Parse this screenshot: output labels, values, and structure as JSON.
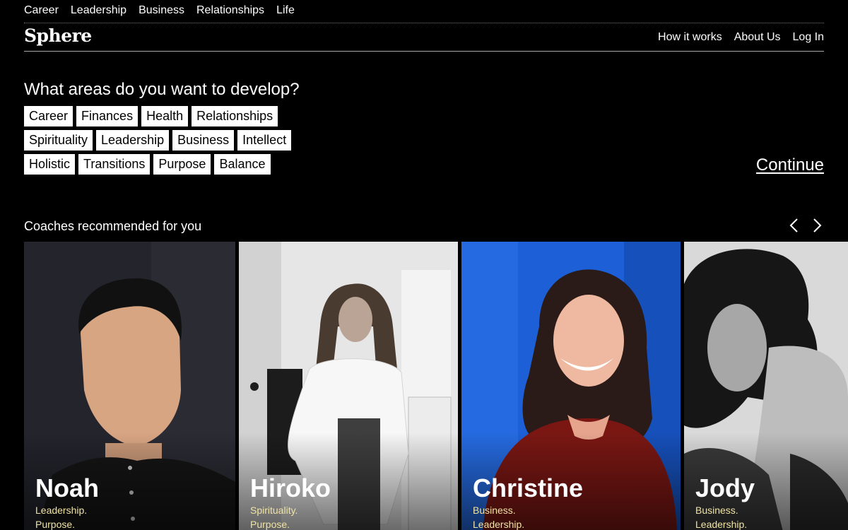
{
  "top_nav": [
    "Career",
    "Leadership",
    "Business",
    "Relationships",
    "Life"
  ],
  "logo": "Sphere",
  "main_nav": [
    "How it works",
    "About Us",
    "Log In"
  ],
  "question": "What areas do you want to develop?",
  "chip_rows": [
    [
      "Career",
      "Finances",
      "Health",
      "Relationships"
    ],
    [
      "Spirituality",
      "Leadership",
      "Business",
      "Intellect"
    ],
    [
      "Holistic",
      "Transitions",
      "Purpose",
      "Balance"
    ]
  ],
  "continue_label": "Continue",
  "coaches_title": "Coaches recommended for you",
  "coaches": [
    {
      "name": "Noah",
      "tags": [
        "Leadership.",
        "Purpose."
      ]
    },
    {
      "name": "Hiroko",
      "tags": [
        "Spirituality.",
        "Purpose."
      ]
    },
    {
      "name": "Christine",
      "tags": [
        "Business.",
        "Leadership."
      ]
    },
    {
      "name": "Jody",
      "tags": [
        "Business.",
        "Leadership."
      ]
    }
  ],
  "colors": {
    "background": "#000000",
    "chip_bg": "#ffffff",
    "tag_text": "#f1e3a3"
  }
}
